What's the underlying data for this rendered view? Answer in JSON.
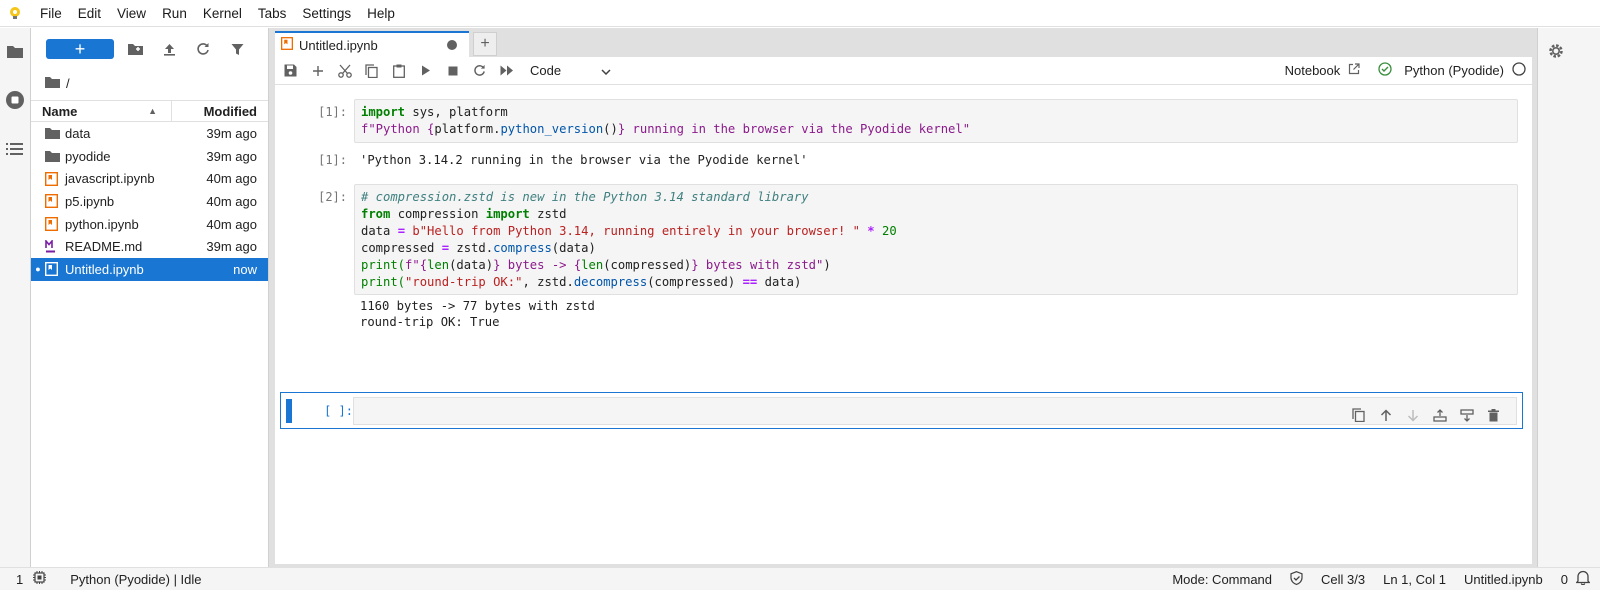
{
  "menubar": {
    "items": [
      "File",
      "Edit",
      "View",
      "Run",
      "Kernel",
      "Tabs",
      "Settings",
      "Help"
    ]
  },
  "filebrowser": {
    "new_label": "+",
    "path": "/",
    "col_name": "Name",
    "col_modified": "Modified",
    "files": [
      {
        "name": "data",
        "modified": "39m ago",
        "type": "folder"
      },
      {
        "name": "pyodide",
        "modified": "39m ago",
        "type": "folder"
      },
      {
        "name": "javascript.ipynb",
        "modified": "40m ago",
        "type": "notebook"
      },
      {
        "name": "p5.ipynb",
        "modified": "40m ago",
        "type": "notebook"
      },
      {
        "name": "python.ipynb",
        "modified": "40m ago",
        "type": "notebook"
      },
      {
        "name": "README.md",
        "modified": "39m ago",
        "type": "markdown"
      },
      {
        "name": "Untitled.ipynb",
        "modified": "now",
        "type": "notebook",
        "selected": true,
        "running_dot": "●"
      }
    ]
  },
  "tab": {
    "title": "Untitled.ipynb",
    "add_label": "+"
  },
  "toolbar": {
    "cell_type": "Code",
    "notebook_label": "Notebook",
    "kernel_name": "Python (Pyodide)"
  },
  "cells": [
    {
      "prompt": "[1]:",
      "output_prompt": "[1]:",
      "output": "'Python 3.14.2 running in the browser via the Pyodide kernel'"
    },
    {
      "prompt": "[2]:",
      "output_lines": [
        "1160 bytes -> 77 bytes with zstd",
        "round-trip OK: True"
      ]
    },
    {
      "prompt": "[ ]:"
    }
  ],
  "code": {
    "c1_l1_kw": "import",
    "c1_l1_rest": " sys, platform",
    "c1_l2_a": "f\"Python ",
    "c1_l2_b": "{",
    "c1_l2_c": "platform.",
    "c1_l2_d": "python_version",
    "c1_l2_e": "()",
    "c1_l2_f": "}",
    "c1_l2_g": " running in the browser via the Pyodide kernel\"",
    "c2_l1": "# compression.zstd is new in the Python 3.14 standard library",
    "c2_l2_kw1": "from",
    "c2_l2_mid": " compression ",
    "c2_l2_kw2": "import",
    "c2_l2_end": " zstd",
    "c2_l3_a": "data ",
    "c2_l3_op1": "=",
    "c2_l3_str": " b\"Hello from Python 3.14, running entirely in your browser! \"",
    "c2_l3_op2": " *",
    "c2_l3_num": " 20",
    "c2_l4_a": "compressed ",
    "c2_l4_op": "=",
    "c2_l4_b": " zstd.",
    "c2_l4_fn": "compress",
    "c2_l4_c": "(data)",
    "c2_l5_a": "print(",
    "c2_l5_b": "f\"",
    "c2_l5_c": "{",
    "c2_l5_d": "len",
    "c2_l5_e": "(data)",
    "c2_l5_f": "}",
    "c2_l5_g": " bytes -> ",
    "c2_l5_h": "{",
    "c2_l5_i": "len",
    "c2_l5_j": "(compressed)",
    "c2_l5_k": "}",
    "c2_l5_l": " bytes with zstd\"",
    "c2_l5_m": ")",
    "c2_l6_a": "print(",
    "c2_l6_str": "\"round-trip OK:\"",
    "c2_l6_b": ", zstd.",
    "c2_l6_fn": "decompress",
    "c2_l6_c": "(compressed) ",
    "c2_l6_op": "==",
    "c2_l6_d": " data)"
  },
  "statusbar": {
    "terminals": "1",
    "kernel_status": "Python (Pyodide) | Idle",
    "mode": "Mode: Command",
    "cell": "Cell 3/3",
    "position": "Ln 1, Col 1",
    "filename": "Untitled.ipynb",
    "notifications": "0"
  },
  "colors": {
    "accent": "#1976d2"
  }
}
